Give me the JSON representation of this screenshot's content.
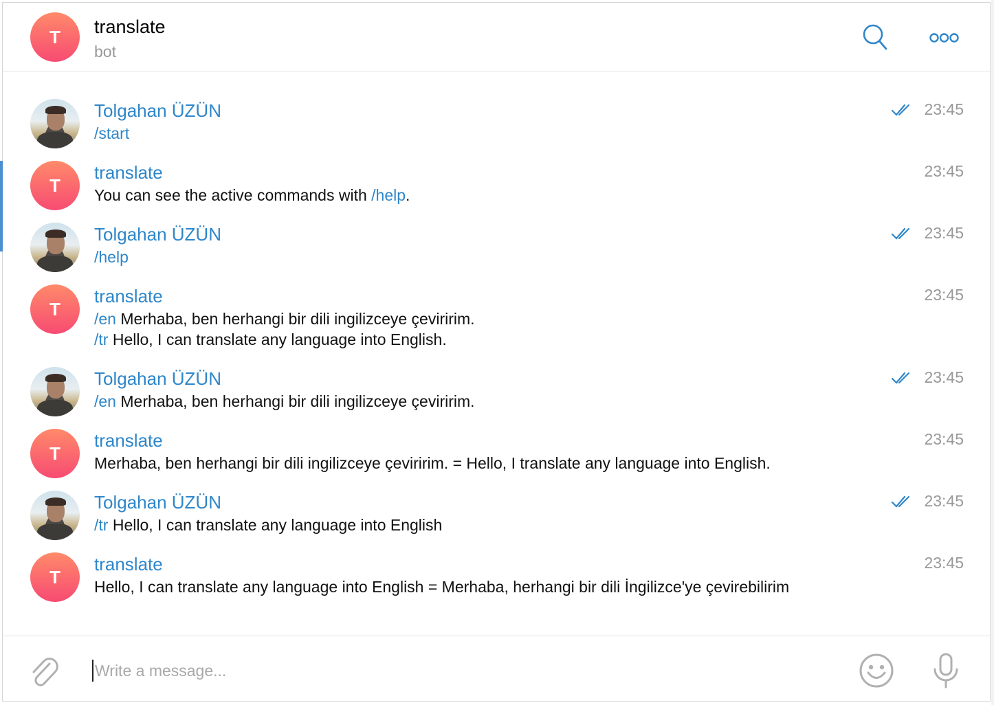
{
  "header": {
    "avatar_letter": "T",
    "title": "translate",
    "status": "bot",
    "search_icon": "search-icon",
    "more_icon": "more-icon"
  },
  "messages": [
    {
      "sender": "Tolgahan ÜZÜN",
      "type": "user",
      "time": "23:45",
      "read": true,
      "lines": [
        [
          {
            "t": "/start",
            "cmd": true
          }
        ]
      ]
    },
    {
      "sender": "translate",
      "type": "bot",
      "avatar_letter": "T",
      "time": "23:45",
      "read": false,
      "lines": [
        [
          {
            "t": "You can see the active commands with ",
            "cmd": false
          },
          {
            "t": "/help",
            "cmd": true
          },
          {
            "t": ".",
            "cmd": false
          }
        ]
      ]
    },
    {
      "sender": "Tolgahan ÜZÜN",
      "type": "user",
      "time": "23:45",
      "read": true,
      "lines": [
        [
          {
            "t": "/help",
            "cmd": true
          }
        ]
      ]
    },
    {
      "sender": "translate",
      "type": "bot",
      "avatar_letter": "T",
      "time": "23:45",
      "read": false,
      "lines": [
        [
          {
            "t": "/en",
            "cmd": true
          },
          {
            "t": " Merhaba, ben herhangi bir dili ingilizceye çeviririm.",
            "cmd": false
          }
        ],
        [
          {
            "t": "/tr",
            "cmd": true
          },
          {
            "t": " Hello, I can translate any language into English.",
            "cmd": false
          }
        ]
      ]
    },
    {
      "sender": "Tolgahan ÜZÜN",
      "type": "user",
      "time": "23:45",
      "read": true,
      "lines": [
        [
          {
            "t": "/en",
            "cmd": true
          },
          {
            "t": " Merhaba, ben herhangi bir dili ingilizceye çeviririm.",
            "cmd": false
          }
        ]
      ]
    },
    {
      "sender": "translate",
      "type": "bot",
      "avatar_letter": "T",
      "time": "23:45",
      "read": false,
      "lines": [
        [
          {
            "t": "Merhaba, ben herhangi bir dili ingilizceye çeviririm. = Hello, I translate any language into English.",
            "cmd": false
          }
        ]
      ]
    },
    {
      "sender": "Tolgahan ÜZÜN",
      "type": "user",
      "time": "23:45",
      "read": true,
      "lines": [
        [
          {
            "t": "/tr",
            "cmd": true
          },
          {
            "t": " Hello, I can translate any language into English",
            "cmd": false
          }
        ]
      ]
    },
    {
      "sender": "translate",
      "type": "bot",
      "avatar_letter": "T",
      "time": "23:45",
      "read": false,
      "lines": [
        [
          {
            "t": "Hello, I can translate any language into English = Merhaba, herhangi bir dili İngilizce'ye çevirebilirim",
            "cmd": false
          }
        ]
      ]
    }
  ],
  "composer": {
    "placeholder": "Write a message...",
    "value": "",
    "attach_icon": "paperclip-icon",
    "emoji_icon": "emoji-icon",
    "mic_icon": "microphone-icon"
  },
  "colors": {
    "accent": "#2e86c9",
    "bot_avatar_top": "#ff8a6a",
    "bot_avatar_bottom": "#f74b72",
    "muted": "#999999",
    "icon_gray": "#b0b0b0"
  }
}
